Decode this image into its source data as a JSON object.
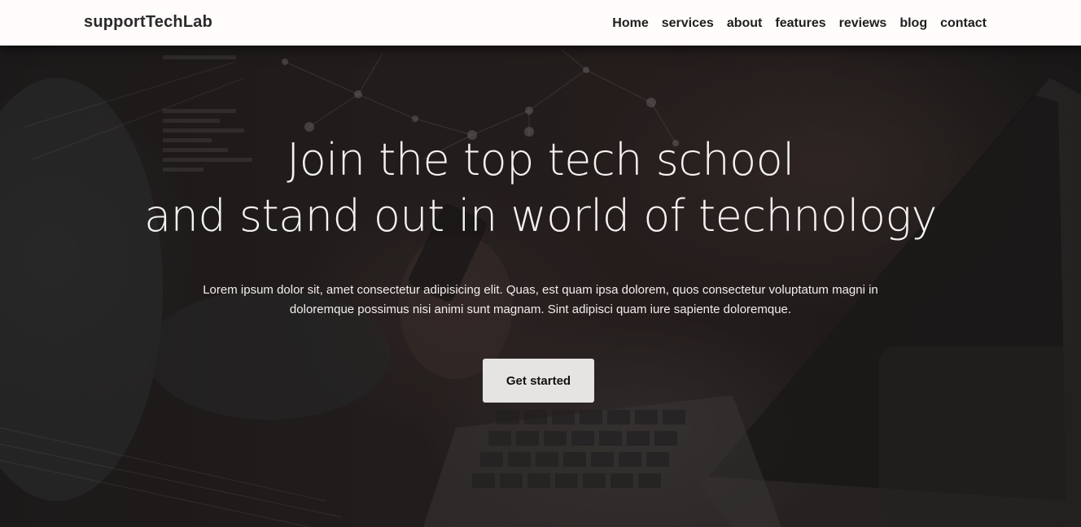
{
  "navbar": {
    "brand": "supportTechLab",
    "links": [
      "Home",
      "services",
      "about",
      "features",
      "reviews",
      "blog",
      "contact"
    ]
  },
  "hero": {
    "headline_line1": "Join the top tech school",
    "headline_line2": "and stand out in world of technology",
    "description": "Lorem ipsum dolor sit, amet consectetur adipisicing elit. Quas, est quam ipsa dolorem, quos consectetur voluptatum magni in doloremque possimus nisi animi sunt magnam. Sint adipisci quam iure sapiente doloremque.",
    "cta_label": "Get started"
  },
  "colors": {
    "navbar_bg": "#fffcfb",
    "hero_overlay": "#1a1818",
    "cta_bg": "#e6e4e2",
    "text_light": "#f4f2f0"
  }
}
